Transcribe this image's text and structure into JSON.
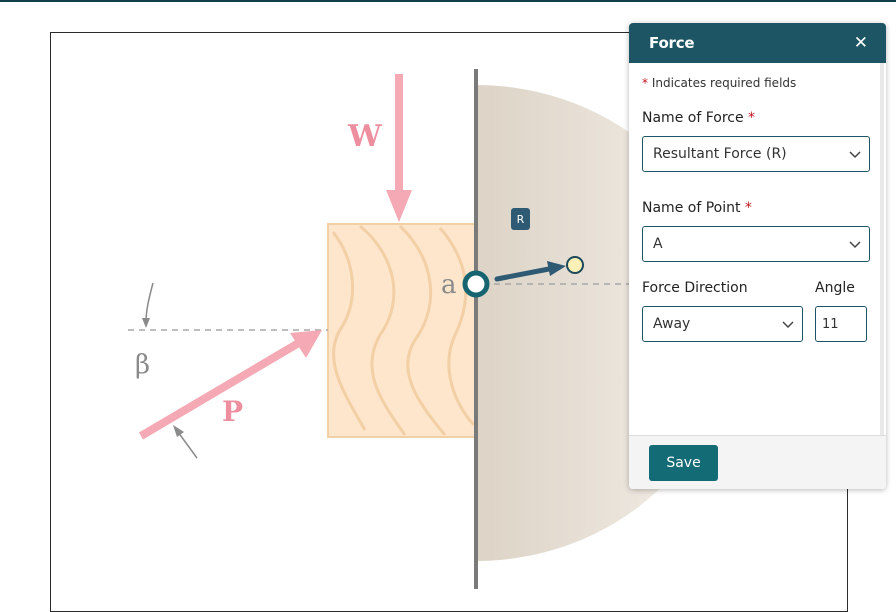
{
  "panel": {
    "title": "Force",
    "close_glyph": "✕",
    "required_note": "Indicates required fields",
    "required_marker": "*",
    "name_of_force_label": "Name of Force",
    "name_of_force_value": "Resultant Force (R)",
    "name_of_point_label": "Name of Point",
    "name_of_point_value": "A",
    "force_direction_label": "Force Direction",
    "force_direction_value": "Away",
    "angle_label": "Angle",
    "angle_value": "11",
    "save_label": "Save"
  },
  "diagram": {
    "weight_label": "W",
    "push_label": "P",
    "angle_symbol": "β",
    "point_label": "a",
    "resultant_badge": "R"
  },
  "colors": {
    "header_teal": "#1d5564",
    "save_teal": "#136b76",
    "force_pink": "#f4a9b4",
    "label_pink": "#ee8fa0",
    "wood_fill": "#fde6cc",
    "required_red": "#c4161c",
    "vector_dark": "#2e5a74"
  }
}
